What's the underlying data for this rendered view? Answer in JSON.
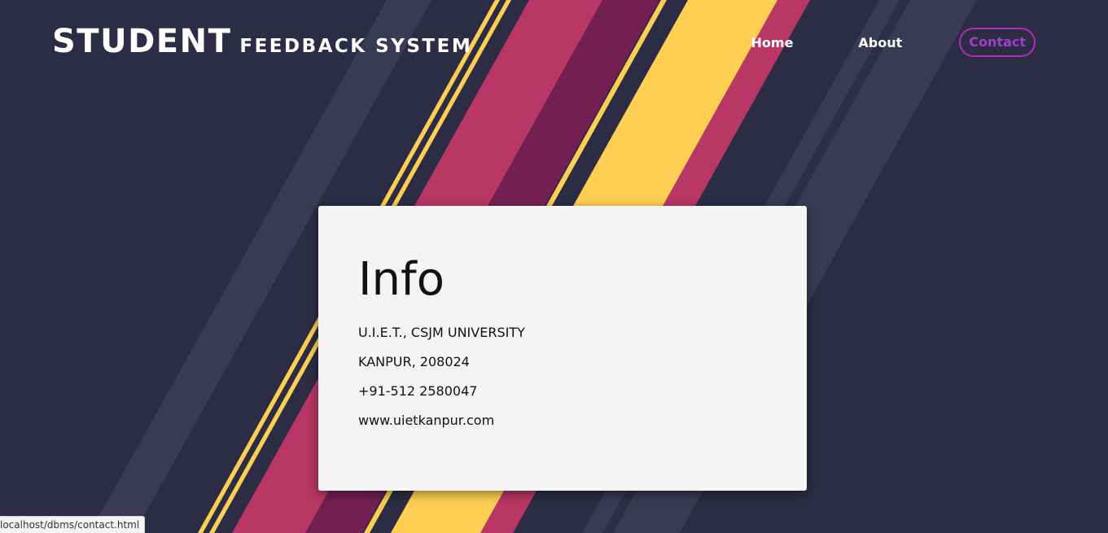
{
  "header": {
    "brand_main": "STUDENT",
    "brand_sub": "FEEDBACK SYSTEM"
  },
  "nav": {
    "home": "Home",
    "about": "About",
    "contact": "Contact"
  },
  "info": {
    "title": "Info",
    "lines": [
      "U.I.E.T., CSJM UNIVERSITY",
      "KANPUR, 208024",
      "+91-512 2580047",
      "www.uietkanpur.com"
    ]
  },
  "status_bar": {
    "url": "localhost/dbms/contact.html"
  },
  "colors": {
    "background": "#2c2c44",
    "stripe_light": "#3a3a54",
    "stripe_pink": "#b83765",
    "stripe_maroon": "#731f52",
    "stripe_yellow": "#fecf53",
    "contact_accent": "#b428bc",
    "card": "#f4f4f4"
  }
}
